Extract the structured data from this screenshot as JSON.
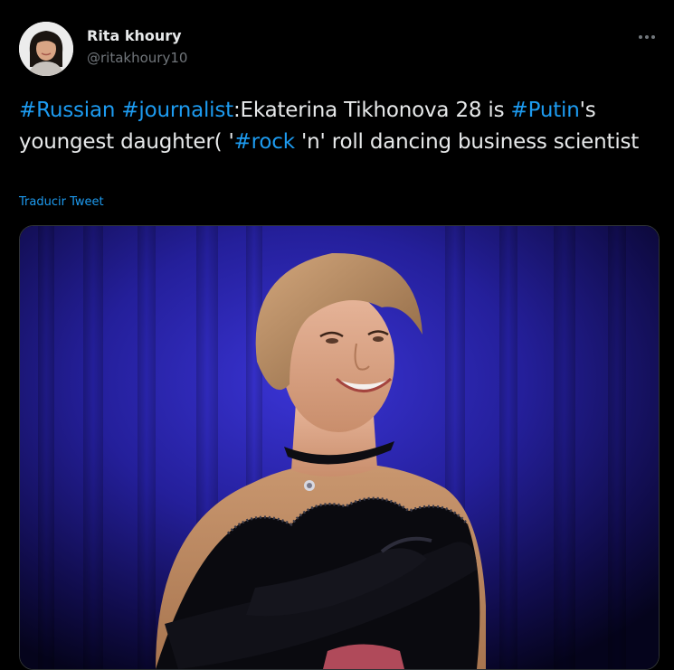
{
  "tweet": {
    "author": {
      "display_name": "Rita khoury",
      "handle": "@ritakhoury10",
      "avatar_icon": "profile-photo"
    },
    "more_icon": "more-dots-icon",
    "text_segments": [
      {
        "text": "#Russian",
        "type": "hashtag"
      },
      {
        "text": " ",
        "type": "plain"
      },
      {
        "text": "#journalist",
        "type": "hashtag"
      },
      {
        "text": ":Ekaterina Tikhonova 28 is ",
        "type": "plain"
      },
      {
        "text": "#Putin",
        "type": "hashtag"
      },
      {
        "text": "'s youngest daughter( '",
        "type": "plain"
      },
      {
        "text": "#rock",
        "type": "hashtag"
      },
      {
        "text": " 'n' roll dancing business scientist",
        "type": "plain"
      }
    ],
    "translate_label": "Traducir Tweet",
    "media": {
      "kind": "photo"
    }
  },
  "colors": {
    "background": "#000000",
    "text": "#e7e9ea",
    "secondary_text": "#71767b",
    "link": "#1d9bf0",
    "border": "#2f3336",
    "stage_blue": "#2a25b8"
  }
}
